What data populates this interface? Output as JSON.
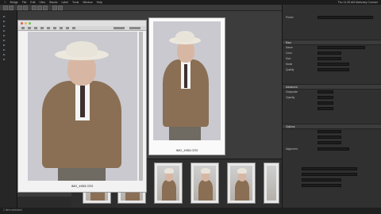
{
  "menubar": {
    "items": [
      "Bridge",
      "File",
      "Edit",
      "View",
      "Stacks",
      "Label",
      "Tools",
      "Window",
      "Help"
    ],
    "right": "Thu 11:25 AM  Mahoney Coroner"
  },
  "main_window": {
    "caption": "IMG_4953.CR2"
  },
  "preview": {
    "caption": "IMG_4953.CR2"
  },
  "filmstrip": {
    "thumb_count": 5
  },
  "right_panel": {
    "sections": [
      "Raw",
      "Advanced",
      "Options"
    ],
    "fields": [
      "Preset",
      "Name",
      "Color",
      "Size",
      "Mode",
      "Quality",
      "Grayscale",
      "Opacity",
      "Alignment"
    ]
  },
  "status": {
    "text": "1 item selected"
  },
  "colors": {
    "coat": "#8a6f54",
    "backdrop": "#c9c9cf",
    "panel": "#303030"
  }
}
